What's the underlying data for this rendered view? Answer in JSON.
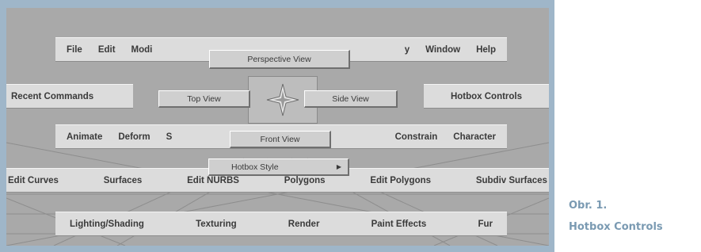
{
  "menus": {
    "row1": [
      "File",
      "Edit",
      "Modi",
      "y",
      "Window",
      "Help"
    ],
    "row2": [
      "Animate",
      "Deform",
      "S",
      "Constrain",
      "Character"
    ],
    "row3": [
      "Edit Curves",
      "Surfaces",
      "Edit NURBS",
      "Polygons",
      "Edit Polygons",
      "Subdiv Surfaces"
    ],
    "row4": [
      "Lighting/Shading",
      "Texturing",
      "Render",
      "Paint Effects",
      "Fur"
    ]
  },
  "side_labels": {
    "recent": "Recent Commands",
    "hotbox_controls": "Hotbox Controls"
  },
  "views": {
    "perspective": "Perspective View",
    "top": "Top View",
    "side": "Side View",
    "front": "Front View",
    "hotbox_style": "Hotbox Style",
    "submenu_arrow": "▶"
  },
  "caption": {
    "line1": "Obr. 1.",
    "line2": "Hotbox Controls"
  },
  "colors": {
    "caption": "#7a9ab2",
    "frame": "#9fb6c9"
  }
}
